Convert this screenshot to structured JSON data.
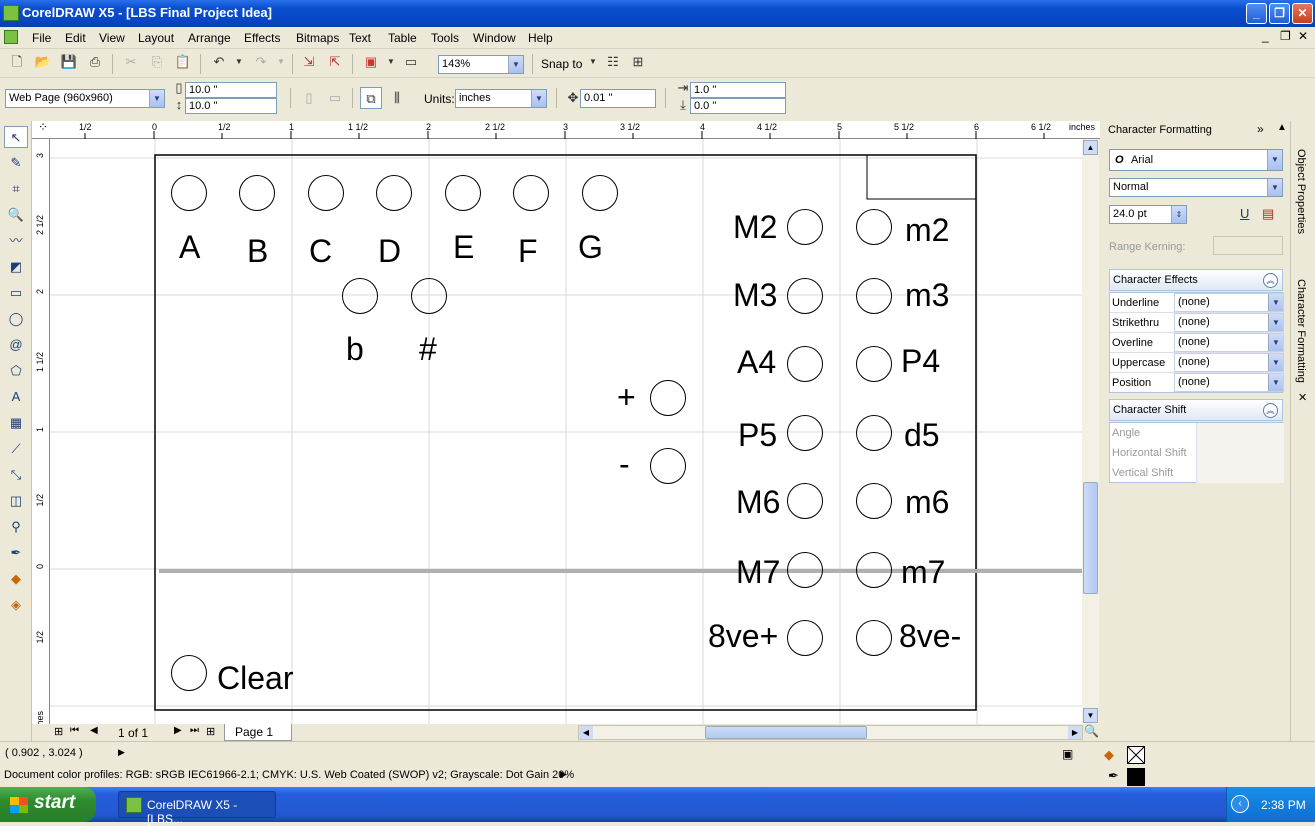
{
  "window": {
    "title": "CorelDRAW X5 - [LBS Final Project Idea]"
  },
  "menubar": {
    "items": [
      "File",
      "Edit",
      "View",
      "Layout",
      "Arrange",
      "Effects",
      "Bitmaps",
      "Text",
      "Table",
      "Tools",
      "Window",
      "Help"
    ]
  },
  "toolbar": {
    "zoom": "143%",
    "snap_to": "Snap to"
  },
  "propertybar": {
    "page_preset": "Web Page (960x960)",
    "width": "10.0 \"",
    "height": "10.0 \"",
    "units_label": "Units:",
    "units": "inches",
    "nudge": "0.01 \"",
    "dup_x": "1.0 \"",
    "dup_y": "0.0 \""
  },
  "ruler": {
    "unit": "inches",
    "h_ticks": [
      "1/2",
      "0",
      "1/2",
      "1",
      "1 1/2",
      "2",
      "2 1/2",
      "3",
      "3 1/2",
      "4",
      "4 1/2",
      "5",
      "5 1/2",
      "6",
      "6 1/2"
    ],
    "v_ticks": [
      "3",
      "2 1/2",
      "2",
      "1 1/2",
      "1",
      "1/2",
      "0",
      "1/2"
    ]
  },
  "canvas": {
    "notes": [
      "A",
      "B",
      "C",
      "D",
      "E",
      "F",
      "G"
    ],
    "accidentals": [
      "b",
      "#"
    ],
    "plus": "+",
    "minus": "-",
    "intervals_major": [
      "M2",
      "M3",
      "A4",
      "P5",
      "M6",
      "M7",
      "8ve+"
    ],
    "intervals_minor": [
      "m2",
      "m3",
      "P4",
      "d5",
      "m6",
      "m7",
      "8ve-"
    ],
    "clear": "Clear"
  },
  "page_nav": {
    "count": "1 of 1",
    "tab": "Page 1"
  },
  "docker": {
    "title": "Character Formatting",
    "font": "Arial",
    "style": "Normal",
    "size": "24.0 pt",
    "range_kerning_label": "Range Kerning:",
    "effects_title": "Character Effects",
    "effects": [
      {
        "label": "Underline",
        "value": "(none)"
      },
      {
        "label": "Strikethru",
        "value": "(none)"
      },
      {
        "label": "Overline",
        "value": "(none)"
      },
      {
        "label": "Uppercase",
        "value": "(none)"
      },
      {
        "label": "Position",
        "value": "(none)"
      }
    ],
    "shift_title": "Character Shift",
    "shift": [
      "Angle",
      "Horizontal Shift",
      "Vertical Shift"
    ],
    "side_tabs": [
      "Object Properties",
      "Character Formatting"
    ]
  },
  "status": {
    "coords": "( 0.902 , 3.024 )",
    "profiles": "Document color profiles: RGB: sRGB IEC61966-2.1; CMYK: U.S. Web Coated (SWOP) v2; Grayscale: Dot Gain 20%"
  },
  "taskbar": {
    "start": "start",
    "item": "CorelDRAW X5 - [LBS...",
    "clock": "2:38 PM"
  }
}
